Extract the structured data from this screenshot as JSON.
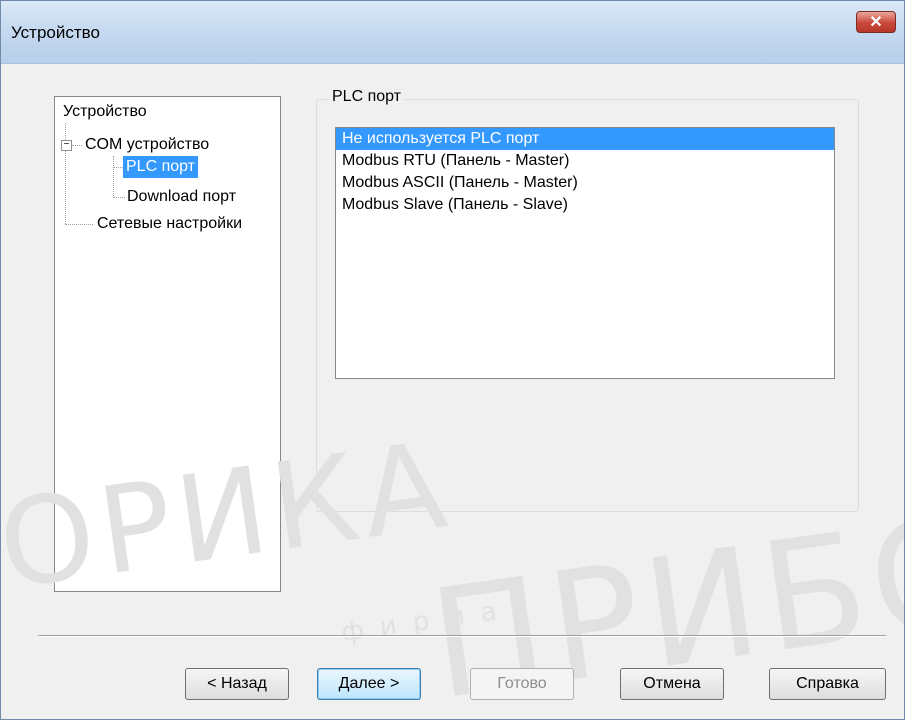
{
  "window": {
    "title": "Устройство",
    "close_label": "✕"
  },
  "tree": {
    "root": "Устройство",
    "com": "COM устройство",
    "expander": "−",
    "plc_port": "PLC порт",
    "download_port": "Download порт",
    "network": "Сетевые настройки"
  },
  "group": {
    "legend": "PLC порт",
    "options": [
      "Не используется PLC порт",
      "Modbus RTU (Панель - Master)",
      "Modbus ASCII (Панель - Master)",
      "Modbus Slave (Панель - Slave)"
    ],
    "selected_index": 0
  },
  "buttons": {
    "back": "< Назад",
    "next": "Далее >",
    "finish": "Готово",
    "cancel": "Отмена",
    "help": "Справка"
  },
  "watermark": {
    "word1": "ОРИКА",
    "small": "ф и р м а",
    "word2": "ПРИБОРИ"
  },
  "colors": {
    "selection": "#3399ff",
    "titlebar": "#c6daf0",
    "close": "#c9483a"
  }
}
